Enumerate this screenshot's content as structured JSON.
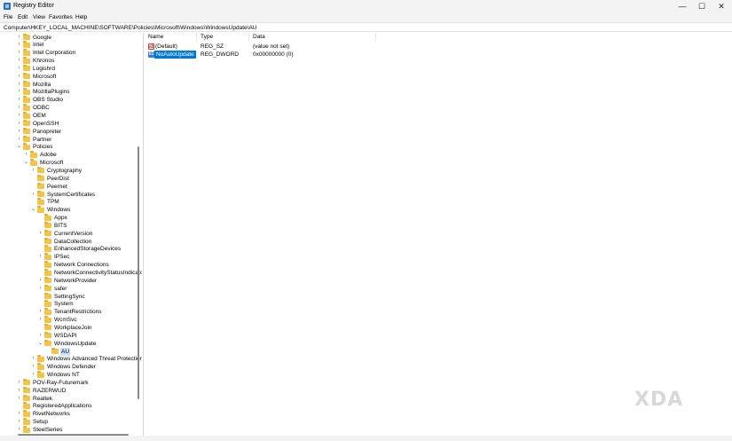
{
  "window": {
    "title": "Registry Editor",
    "minimize_glyph": "—",
    "maximize_glyph": "☐",
    "close_glyph": "✕"
  },
  "menu": [
    "File",
    "Edit",
    "View",
    "Favorites",
    "Help"
  ],
  "address": "Computer\\HKEY_LOCAL_MACHINE\\SOFTWARE\\Policies\\Microsoft\\Windows\\WindowsUpdate\\AU",
  "tree": [
    {
      "label": "Google",
      "level": 0,
      "chev": "›"
    },
    {
      "label": "Intel",
      "level": 0,
      "chev": "›"
    },
    {
      "label": "Intel Corporation",
      "level": 0,
      "chev": "›"
    },
    {
      "label": "Khronos",
      "level": 0,
      "chev": "›"
    },
    {
      "label": "Logishrd",
      "level": 0,
      "chev": "›"
    },
    {
      "label": "Microsoft",
      "level": 0,
      "chev": "›"
    },
    {
      "label": "Mozilla",
      "level": 0,
      "chev": "›"
    },
    {
      "label": "MozillaPlugins",
      "level": 0,
      "chev": "›"
    },
    {
      "label": "OBS Studio",
      "level": 0,
      "chev": "›"
    },
    {
      "label": "ODBC",
      "level": 0,
      "chev": "›"
    },
    {
      "label": "OEM",
      "level": 0,
      "chev": "›"
    },
    {
      "label": "OpenSSH",
      "level": 0,
      "chev": "›"
    },
    {
      "label": "Panopreter",
      "level": 0,
      "chev": "›"
    },
    {
      "label": "Partner",
      "level": 0,
      "chev": "›"
    },
    {
      "label": "Policies",
      "level": 0,
      "chev": "⌄"
    },
    {
      "label": "Adobe",
      "level": 1,
      "chev": "›"
    },
    {
      "label": "Microsoft",
      "level": 1,
      "chev": "⌄"
    },
    {
      "label": "Cryptography",
      "level": 2,
      "chev": "›"
    },
    {
      "label": "PeerDist",
      "level": 2,
      "chev": ""
    },
    {
      "label": "Peernet",
      "level": 2,
      "chev": ""
    },
    {
      "label": "SystemCertificates",
      "level": 2,
      "chev": "›"
    },
    {
      "label": "TPM",
      "level": 2,
      "chev": ""
    },
    {
      "label": "Windows",
      "level": 2,
      "chev": "⌄"
    },
    {
      "label": "Appx",
      "level": 3,
      "chev": ""
    },
    {
      "label": "BITS",
      "level": 3,
      "chev": ""
    },
    {
      "label": "CurrentVersion",
      "level": 3,
      "chev": "›"
    },
    {
      "label": "DataCollection",
      "level": 3,
      "chev": ""
    },
    {
      "label": "EnhancedStorageDevices",
      "level": 3,
      "chev": ""
    },
    {
      "label": "IPSec",
      "level": 3,
      "chev": "›"
    },
    {
      "label": "Network Connections",
      "level": 3,
      "chev": ""
    },
    {
      "label": "NetworkConnectivityStatusIndicator",
      "level": 3,
      "chev": ""
    },
    {
      "label": "NetworkProvider",
      "level": 3,
      "chev": "›"
    },
    {
      "label": "safer",
      "level": 3,
      "chev": "›"
    },
    {
      "label": "SettingSync",
      "level": 3,
      "chev": ""
    },
    {
      "label": "System",
      "level": 3,
      "chev": ""
    },
    {
      "label": "TenantRestrictions",
      "level": 3,
      "chev": "›"
    },
    {
      "label": "WcmSvc",
      "level": 3,
      "chev": "›"
    },
    {
      "label": "WorkplaceJoin",
      "level": 3,
      "chev": ""
    },
    {
      "label": "WSDAPI",
      "level": 3,
      "chev": "›"
    },
    {
      "label": "WindowsUpdate",
      "level": 3,
      "chev": "⌄"
    },
    {
      "label": "AU",
      "level": 4,
      "chev": "",
      "selected": true
    },
    {
      "label": "Windows Advanced Threat Protection",
      "level": 2,
      "chev": "›"
    },
    {
      "label": "Windows Defender",
      "level": 2,
      "chev": "›"
    },
    {
      "label": "Windows NT",
      "level": 2,
      "chev": "›"
    },
    {
      "label": "POV-Ray-Futuremark",
      "level": 0,
      "chev": "›"
    },
    {
      "label": "RAZERWUD",
      "level": 0,
      "chev": "›"
    },
    {
      "label": "Realtek",
      "level": 0,
      "chev": "›"
    },
    {
      "label": "RegisteredApplications",
      "level": 0,
      "chev": ""
    },
    {
      "label": "RivetNetworks",
      "level": 0,
      "chev": "›"
    },
    {
      "label": "Setup",
      "level": 0,
      "chev": "›"
    },
    {
      "label": "SteelSeries",
      "level": 0,
      "chev": "›"
    }
  ],
  "columns": {
    "name": "Name",
    "type": "Type",
    "data": "Data"
  },
  "values": [
    {
      "icon": "string-value-icon",
      "icon_glyph": "ab",
      "name": "(Default)",
      "type": "REG_SZ",
      "data": "(value not set)",
      "selected": false
    },
    {
      "icon": "dword-value-icon",
      "icon_glyph": "01",
      "name": "NoAutoUpdate",
      "type": "REG_DWORD",
      "data": "0x00000000 (0)",
      "selected": true
    }
  ],
  "watermark": "XDA"
}
